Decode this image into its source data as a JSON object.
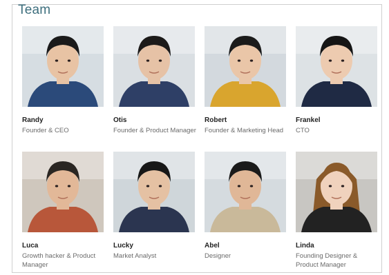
{
  "section": {
    "title": "Team"
  },
  "members": [
    {
      "name": "Randy",
      "role": "Founder & CEO",
      "shirt": "#2b4a7a",
      "bg": "#d6dde2",
      "hair": "#1a1a1a",
      "skin": "#e8c3a4"
    },
    {
      "name": "Otis",
      "role": "Founder & Product Manager",
      "shirt": "#2e3f66",
      "bg": "#dadfe3",
      "hair": "#1c1a19",
      "skin": "#e6c2a6"
    },
    {
      "name": "Robert",
      "role": "Founder & Marketing Head",
      "shirt": "#d9a52e",
      "bg": "#d3d9de",
      "hair": "#1b1b1b",
      "skin": "#eac6a8"
    },
    {
      "name": "Frankel",
      "role": "CTO",
      "shirt": "#1f2a44",
      "bg": "#dde2e5",
      "hair": "#151515",
      "skin": "#edcbb0"
    },
    {
      "name": "Luca",
      "role": "Growth hacker & Product Manager",
      "shirt": "#b8573a",
      "bg": "#cfc7bd",
      "hair": "#2a2622",
      "skin": "#e2b898"
    },
    {
      "name": "Lucky",
      "role": "Market Analyst",
      "shirt": "#2b3550",
      "bg": "#cfd6da",
      "hair": "#171717",
      "skin": "#e5c1a3"
    },
    {
      "name": "Abel",
      "role": "Designer",
      "shirt": "#c9b99a",
      "bg": "#d5dbdf",
      "hair": "#1a1a1a",
      "skin": "#e0b797"
    },
    {
      "name": "Linda",
      "role": "Founding Designer & Product Manager",
      "shirt": "#222222",
      "bg": "#c8c6c2",
      "hair": "#8a5a2a",
      "skin": "#f0d2bd"
    }
  ]
}
